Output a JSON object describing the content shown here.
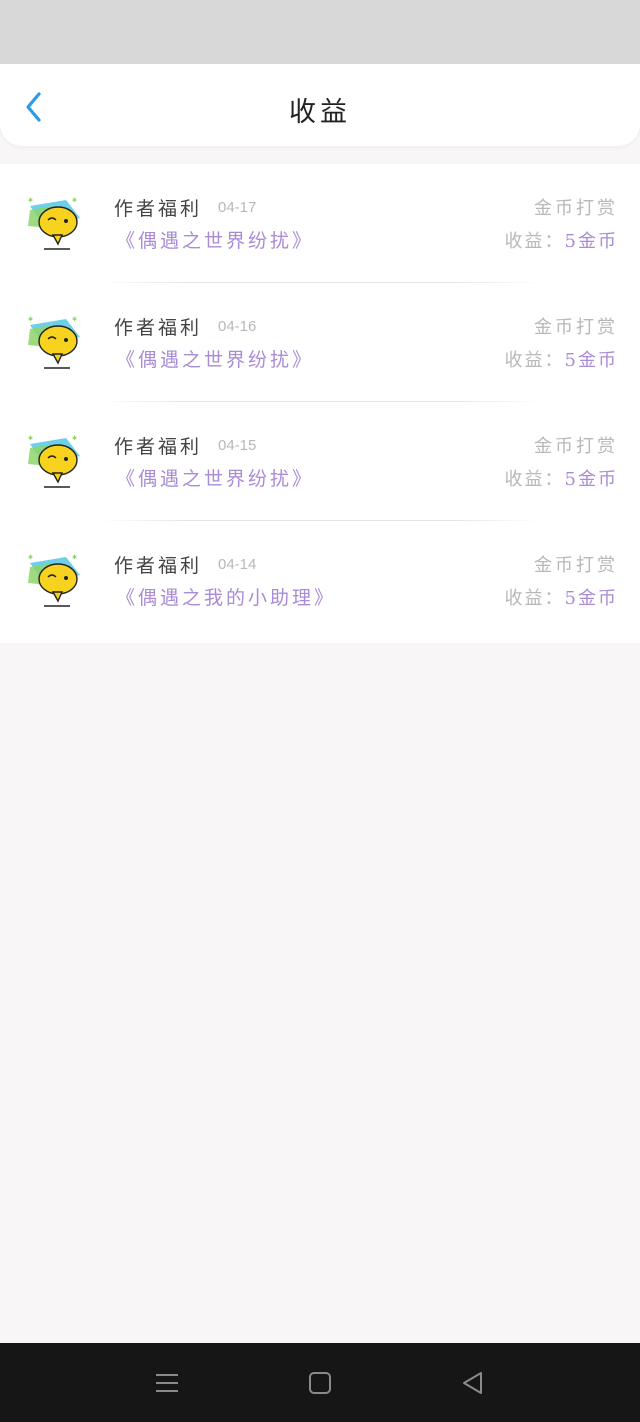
{
  "header": {
    "title": "收益"
  },
  "icons": {
    "back": "chevron-left-icon",
    "avatar": "speech-bubble-emoji-icon",
    "nav_menu": "menu-icon",
    "nav_home": "square-home-icon",
    "nav_back": "triangle-back-icon"
  },
  "colors": {
    "accent_blue": "#2a9be6",
    "purple_text": "#a98bd6",
    "gray_text": "#b8b8b8",
    "status_bar": "#d8d8d8",
    "nav_bar": "#161616"
  },
  "records": [
    {
      "source": "作者福利",
      "date": "04-17",
      "book": "《偶遇之世界纷扰》",
      "type": "金币打赏",
      "earning_label": "收益：",
      "earning_amount": "5金币"
    },
    {
      "source": "作者福利",
      "date": "04-16",
      "book": "《偶遇之世界纷扰》",
      "type": "金币打赏",
      "earning_label": "收益：",
      "earning_amount": "5金币"
    },
    {
      "source": "作者福利",
      "date": "04-15",
      "book": "《偶遇之世界纷扰》",
      "type": "金币打赏",
      "earning_label": "收益：",
      "earning_amount": "5金币"
    },
    {
      "source": "作者福利",
      "date": "04-14",
      "book": "《偶遇之我的小助理》",
      "type": "金币打赏",
      "earning_label": "收益：",
      "earning_amount": "5金币"
    }
  ]
}
